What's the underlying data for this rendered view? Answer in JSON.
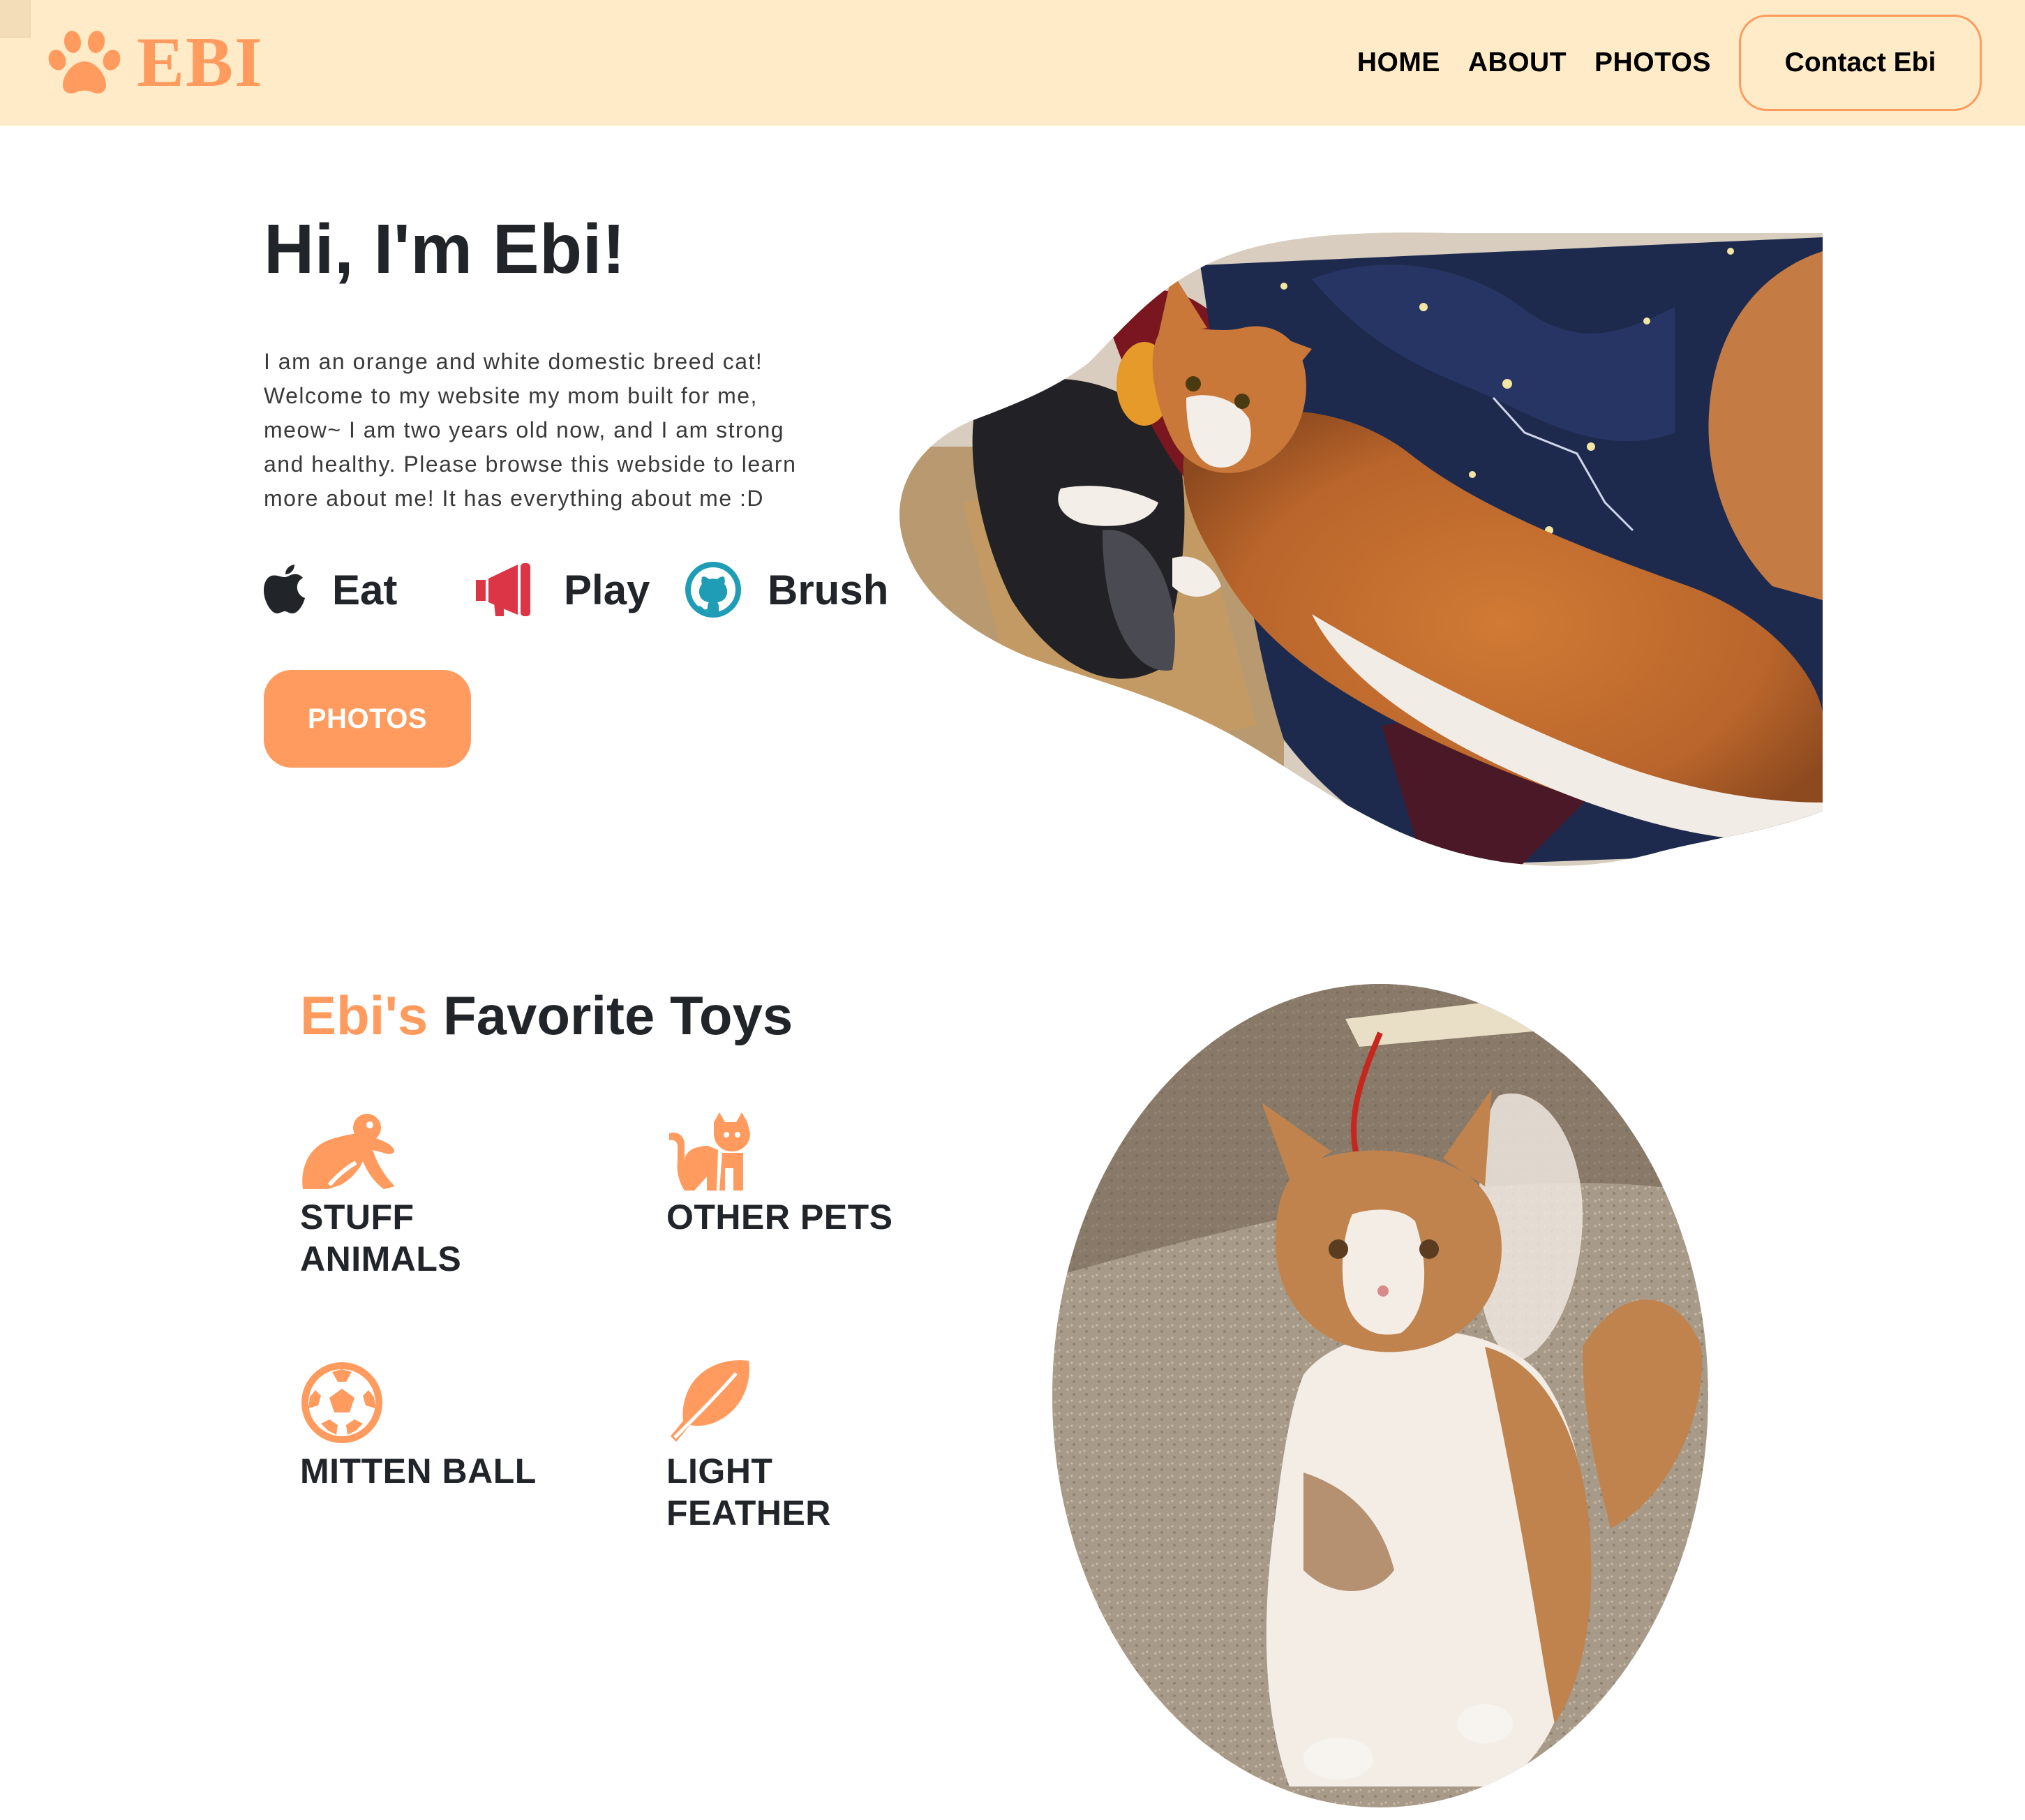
{
  "header": {
    "brand": "EBI",
    "nav": [
      "HOME",
      "ABOUT",
      "PHOTOS"
    ],
    "contact_label": "Contact Ebi"
  },
  "hero": {
    "title": "Hi, I'm Ebi!",
    "description_lines": [
      "I am an orange and white domestic breed cat!",
      "Welcome to my website my mom built for me,",
      "meow~ I am two years old now, and I am strong",
      "and healthy. Please browse this webside to learn",
      "more about me! It has everything about me :D"
    ],
    "skills": [
      {
        "icon": "apple-icon",
        "label": "Eat",
        "color": "#212529"
      },
      {
        "icon": "megaphone-icon",
        "label": "Play",
        "color": "#dc3545"
      },
      {
        "icon": "github-icon",
        "label": "Brush",
        "color": "#1f9cb6"
      }
    ],
    "photos_button": "PHOTOS"
  },
  "toys": {
    "title_accent": "Ebi's",
    "title_rest": " Favorite Toys",
    "items": [
      {
        "icon": "frog-icon",
        "label_lines": [
          "STUFF",
          "ANIMALS"
        ]
      },
      {
        "icon": "cat-icon",
        "label_lines": [
          "OTHER PETS"
        ]
      },
      {
        "icon": "soccer-ball-icon",
        "label_lines": [
          "MITTEN BALL"
        ]
      },
      {
        "icon": "feather-icon",
        "label_lines": [
          "LIGHT",
          "FEATHER"
        ]
      }
    ]
  },
  "colors": {
    "header_bg": "#ffebc8",
    "accent": "#ff9b5e",
    "text": "#212529"
  }
}
